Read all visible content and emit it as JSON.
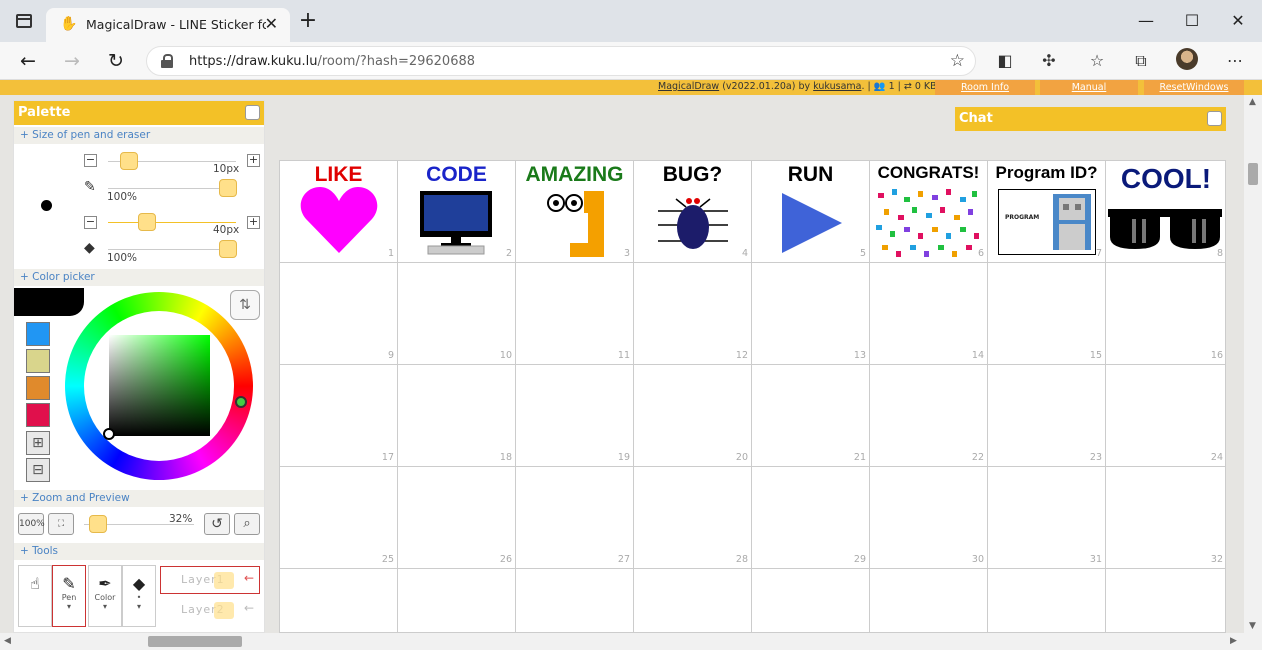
{
  "browser": {
    "tab_title": "MagicalDraw - LINE Sticker for Pc",
    "url_host": "https://draw.kuku.lu",
    "url_path": "/room/?hash=29620688",
    "win_min": "—",
    "win_max": "☐",
    "win_close": "✕"
  },
  "app": {
    "info_name": "MagicalDraw",
    "info_version": " (v2022.01.20a) by ",
    "info_author": "kukusama",
    "info_status": ". | 👥 1 | ⇄ 0 KB",
    "links": [
      "Room Info",
      "Manual",
      "ResetWindows"
    ],
    "chat_title": "Chat"
  },
  "palette": {
    "title": "Palette",
    "sections": [
      "+ Size of pen and eraser",
      "+ Color picker",
      "+ Zoom and Preview",
      "+ Tools"
    ],
    "pen_size": "10px",
    "pen_opacity": "100%",
    "eraser_size": "40px",
    "eraser_opacity": "100%",
    "zoom": "32%",
    "zoom_100_label": "100%",
    "swatch_colors": [
      "#2196f3",
      "#d9d58c",
      "#e08a2c",
      "#e0104c"
    ],
    "tools": [
      {
        "label": "",
        "icon": "hand-icon"
      },
      {
        "label": "Pen",
        "icon": "pen-icon"
      },
      {
        "label": "Color",
        "icon": "dropper-icon"
      },
      {
        "label": "•",
        "icon": "eraser-icon"
      }
    ],
    "layers": [
      "Layer1",
      "Layer2"
    ]
  },
  "stickers": [
    {
      "num": "1",
      "label": "LIKE",
      "color": "#e00000"
    },
    {
      "num": "2",
      "label": "CODE",
      "color": "#1a24c9"
    },
    {
      "num": "3",
      "label": "AMAZING",
      "color": "#1a7a1a"
    },
    {
      "num": "4",
      "label": "BUG?",
      "color": "#000000"
    },
    {
      "num": "5",
      "label": "RUN",
      "color": "#000000"
    },
    {
      "num": "6",
      "label": "CONGRATS!",
      "color": "#000000"
    },
    {
      "num": "7",
      "label": "Program ID?",
      "color": "#000000"
    },
    {
      "num": "8",
      "label": "COOL!",
      "color": "#0a1a7a"
    }
  ],
  "program_label": "PROGRAM",
  "empty_cells": [
    "9",
    "10",
    "11",
    "12",
    "13",
    "14",
    "15",
    "16",
    "17",
    "18",
    "19",
    "20",
    "21",
    "22",
    "23",
    "24",
    "25",
    "26",
    "27",
    "28",
    "29",
    "30",
    "31",
    "32"
  ]
}
